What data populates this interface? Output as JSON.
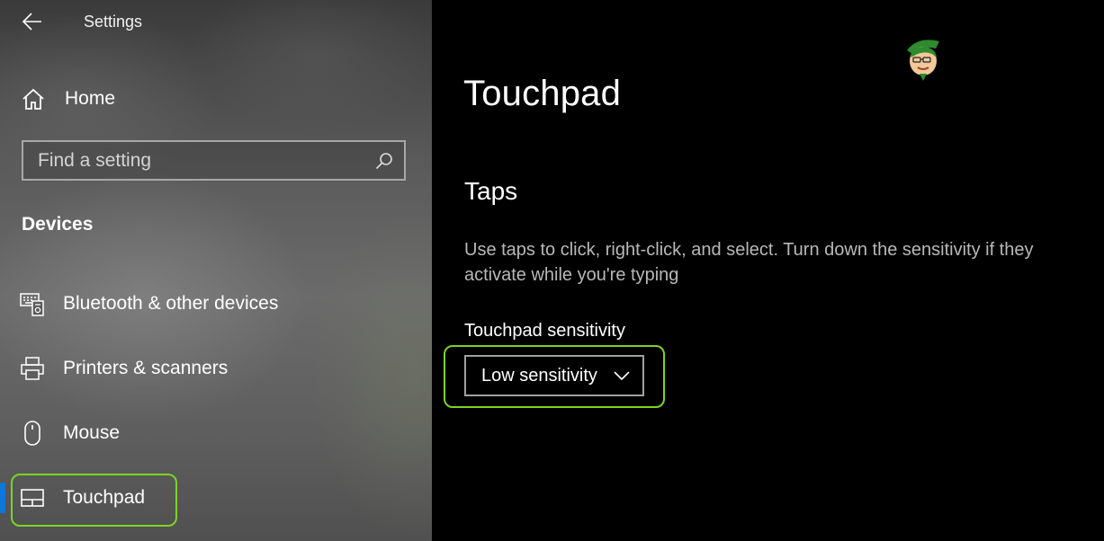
{
  "window": {
    "title": "Settings"
  },
  "sidebar": {
    "home_label": "Home",
    "search": {
      "placeholder": "Find a setting",
      "value": ""
    },
    "section_heading": "Devices",
    "items": [
      {
        "label": "Bluetooth & other devices",
        "icon": "bluetooth-devices-icon"
      },
      {
        "label": "Printers & scanners",
        "icon": "printer-icon"
      },
      {
        "label": "Mouse",
        "icon": "mouse-icon"
      },
      {
        "label": "Touchpad",
        "icon": "touchpad-icon",
        "selected": true
      }
    ]
  },
  "main": {
    "page_title": "Touchpad",
    "group_title": "Taps",
    "description": "Use taps to click, right-click, and select. Turn down the sensitivity if they activate while you're typing",
    "sensitivity": {
      "label": "Touchpad sensitivity",
      "selected_value": "Low sensitivity"
    }
  },
  "colors": {
    "accent": "#0a78d7",
    "highlight": "#7ed321",
    "background": "#000000"
  }
}
